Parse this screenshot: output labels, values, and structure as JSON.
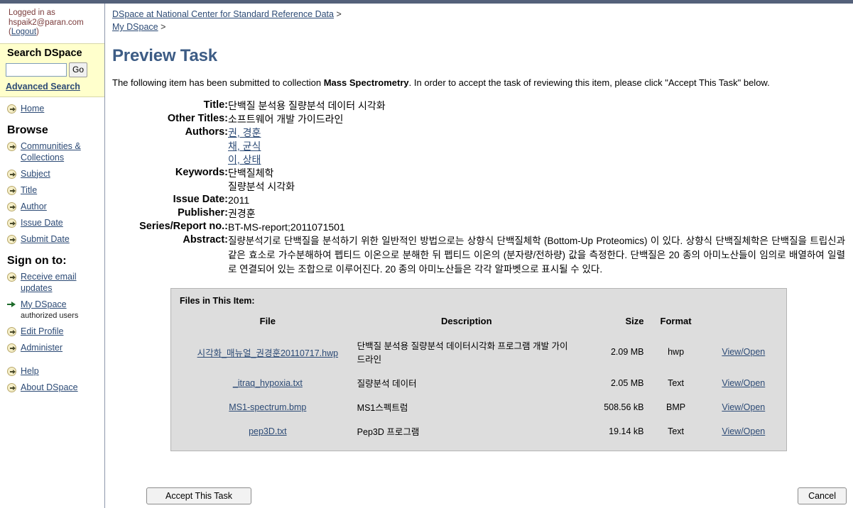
{
  "account": {
    "logged_in_prefix": "Logged in as",
    "email": "hspaik2@paran.com",
    "logout_open": "(",
    "logout_label": "Logout",
    "logout_close": ")"
  },
  "search": {
    "heading": "Search DSpace",
    "value": "",
    "placeholder": "",
    "go_label": "Go",
    "advanced_label": "Advanced Search"
  },
  "sidebar": {
    "home_label": "Home",
    "browse_heading": "Browse",
    "browse_items": [
      {
        "label": "Communities & Collections",
        "icon": "arrow-bullet-icon"
      },
      {
        "label": "Subject",
        "icon": "arrow-bullet-icon"
      },
      {
        "label": "Title",
        "icon": "arrow-bullet-icon"
      },
      {
        "label": "Author",
        "icon": "arrow-bullet-icon"
      },
      {
        "label": "Issue Date",
        "icon": "arrow-bullet-icon"
      },
      {
        "label": "Submit Date",
        "icon": "arrow-bullet-icon"
      }
    ],
    "signon_heading": "Sign on to:",
    "signon_items": [
      {
        "label": "Receive email updates",
        "icon": "arrow-bullet-icon",
        "note": ""
      },
      {
        "label": "My DSpace",
        "icon": "green-arrow-icon",
        "note": "authorized users"
      },
      {
        "label": "Edit Profile",
        "icon": "arrow-bullet-icon",
        "note": ""
      },
      {
        "label": "Administer",
        "icon": "arrow-bullet-icon",
        "note": ""
      }
    ],
    "help_items": [
      {
        "label": "Help",
        "icon": "arrow-bullet-icon"
      },
      {
        "label": "About DSpace",
        "icon": "arrow-bullet-icon"
      }
    ]
  },
  "breadcrumb": {
    "home_label": "DSpace at National Center for Standard Reference Data",
    "sep": ">",
    "second_label": "My DSpace",
    "sep2": ">"
  },
  "page": {
    "title": "Preview Task",
    "intro_part1": "The following item has been submitted to collection ",
    "intro_collection": "Mass Spectrometry",
    "intro_part2": ". In order to accept the task of reviewing this item, please click \"Accept This Task\" below."
  },
  "metadata": {
    "title_label": "Title:",
    "title_value": "단백질 분석용 질량분석 데이터 시각화",
    "other_titles_label": "Other Titles:",
    "other_titles_value": "소프트웨어 개발 가이드라인",
    "authors_label": "Authors:",
    "authors": [
      "권, 경훈",
      "채, 균식",
      "이, 상태"
    ],
    "keywords_label": "Keywords:",
    "keywords": [
      "단백질체학",
      "질량분석 시각화"
    ],
    "issue_date_label": "Issue Date:",
    "issue_date_value": "2011",
    "publisher_label": "Publisher:",
    "publisher_value": "권경훈",
    "series_label": "Series/Report no.:",
    "series_value": "BT-MS-report;2011071501",
    "abstract_label": "Abstract:",
    "abstract_value": "질량분석기로 단백질을 분석하기 위한 일반적인 방법으로는 상향식 단백질체학 (Bottom-Up Proteomics) 이 있다. 상향식 단백질체학은 단백질을 트립신과 같은 효소로 가수분해하여 펩티드 이온으로 분해한 뒤 펩티드 이온의 (분자량/전하량) 값을 측정한다. 단백질은 20 종의 아미노산들이 임의로 배열하여 일렬로 연결되어 있는 조합으로 이루어진다. 20 종의 아미노산들은 각각 알파벳으로 표시될 수 있다."
  },
  "files_panel": {
    "heading": "Files in This Item:",
    "columns": [
      "File",
      "Description",
      "Size",
      "Format",
      ""
    ],
    "rows": [
      {
        "file": "시각화_매뉴얼_권경훈20110717.hwp",
        "description": "단백질 분석용 질량분석 데이터시각화 프로그램 개발 가이드라인",
        "size": "2.09 MB",
        "format": "hwp",
        "view": "View/Open"
      },
      {
        "file": "_itraq_hypoxia.txt",
        "description": "질량분석 데이터",
        "size": "2.05 MB",
        "format": "Text",
        "view": "View/Open"
      },
      {
        "file": "MS1-spectrum.bmp",
        "description": "MS1스펙트럼",
        "size": "508.56 kB",
        "format": "BMP",
        "view": "View/Open"
      },
      {
        "file": "pep3D.txt",
        "description": "Pep3D 프로그램",
        "size": "19.14 kB",
        "format": "Text",
        "view": "View/Open"
      }
    ]
  },
  "actions": {
    "accept_label": "Accept This Task",
    "cancel_label": "Cancel"
  },
  "colors": {
    "top_strip": "#54617a",
    "heading": "#3d5c85",
    "link": "#2c4a75",
    "search_bg": "#ffffcc",
    "panel_bg": "#dddddd",
    "logged_in_text": "#7a3b3b",
    "current_arrow": "#1d6b2a"
  }
}
